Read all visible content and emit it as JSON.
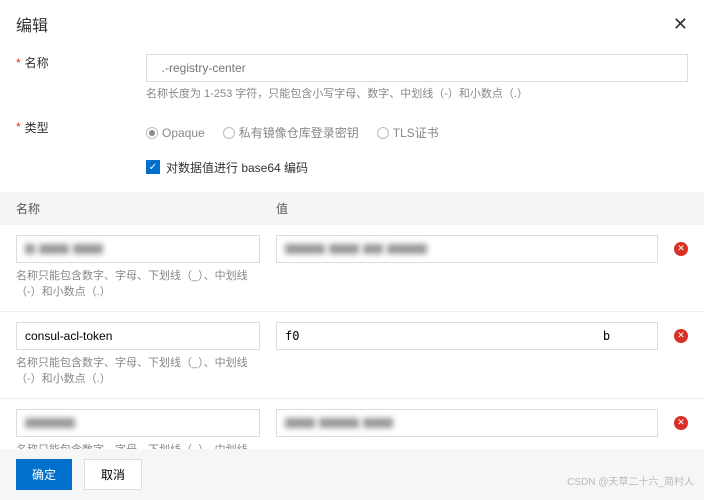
{
  "header": {
    "title": "编辑",
    "close": "✕"
  },
  "name": {
    "label": "名称",
    "placeholder": "  .-registry-center",
    "hint": "名称长度为 1-253 字符，只能包含小写字母、数字、中划线（-）和小数点（.）"
  },
  "type": {
    "label": "类型",
    "options": [
      "Opaque",
      "私有镜像仓库登录密钥",
      "TLS证书"
    ],
    "checkbox_label": "对数据值进行 base64 编码"
  },
  "table": {
    "col_name": "名称",
    "col_value": "值"
  },
  "rows": [
    {
      "name": "",
      "value": ""
    },
    {
      "name": "consul-acl-token",
      "value": "f0                                          b"
    },
    {
      "name": "",
      "value": ""
    }
  ],
  "row_hint": "名称只能包含数字、字母、下划线（_）、中划线（-）和小数点（.）",
  "footer": {
    "ok": "确定",
    "cancel": "取消"
  },
  "watermark": "CSDN @天草二十六_简村人"
}
